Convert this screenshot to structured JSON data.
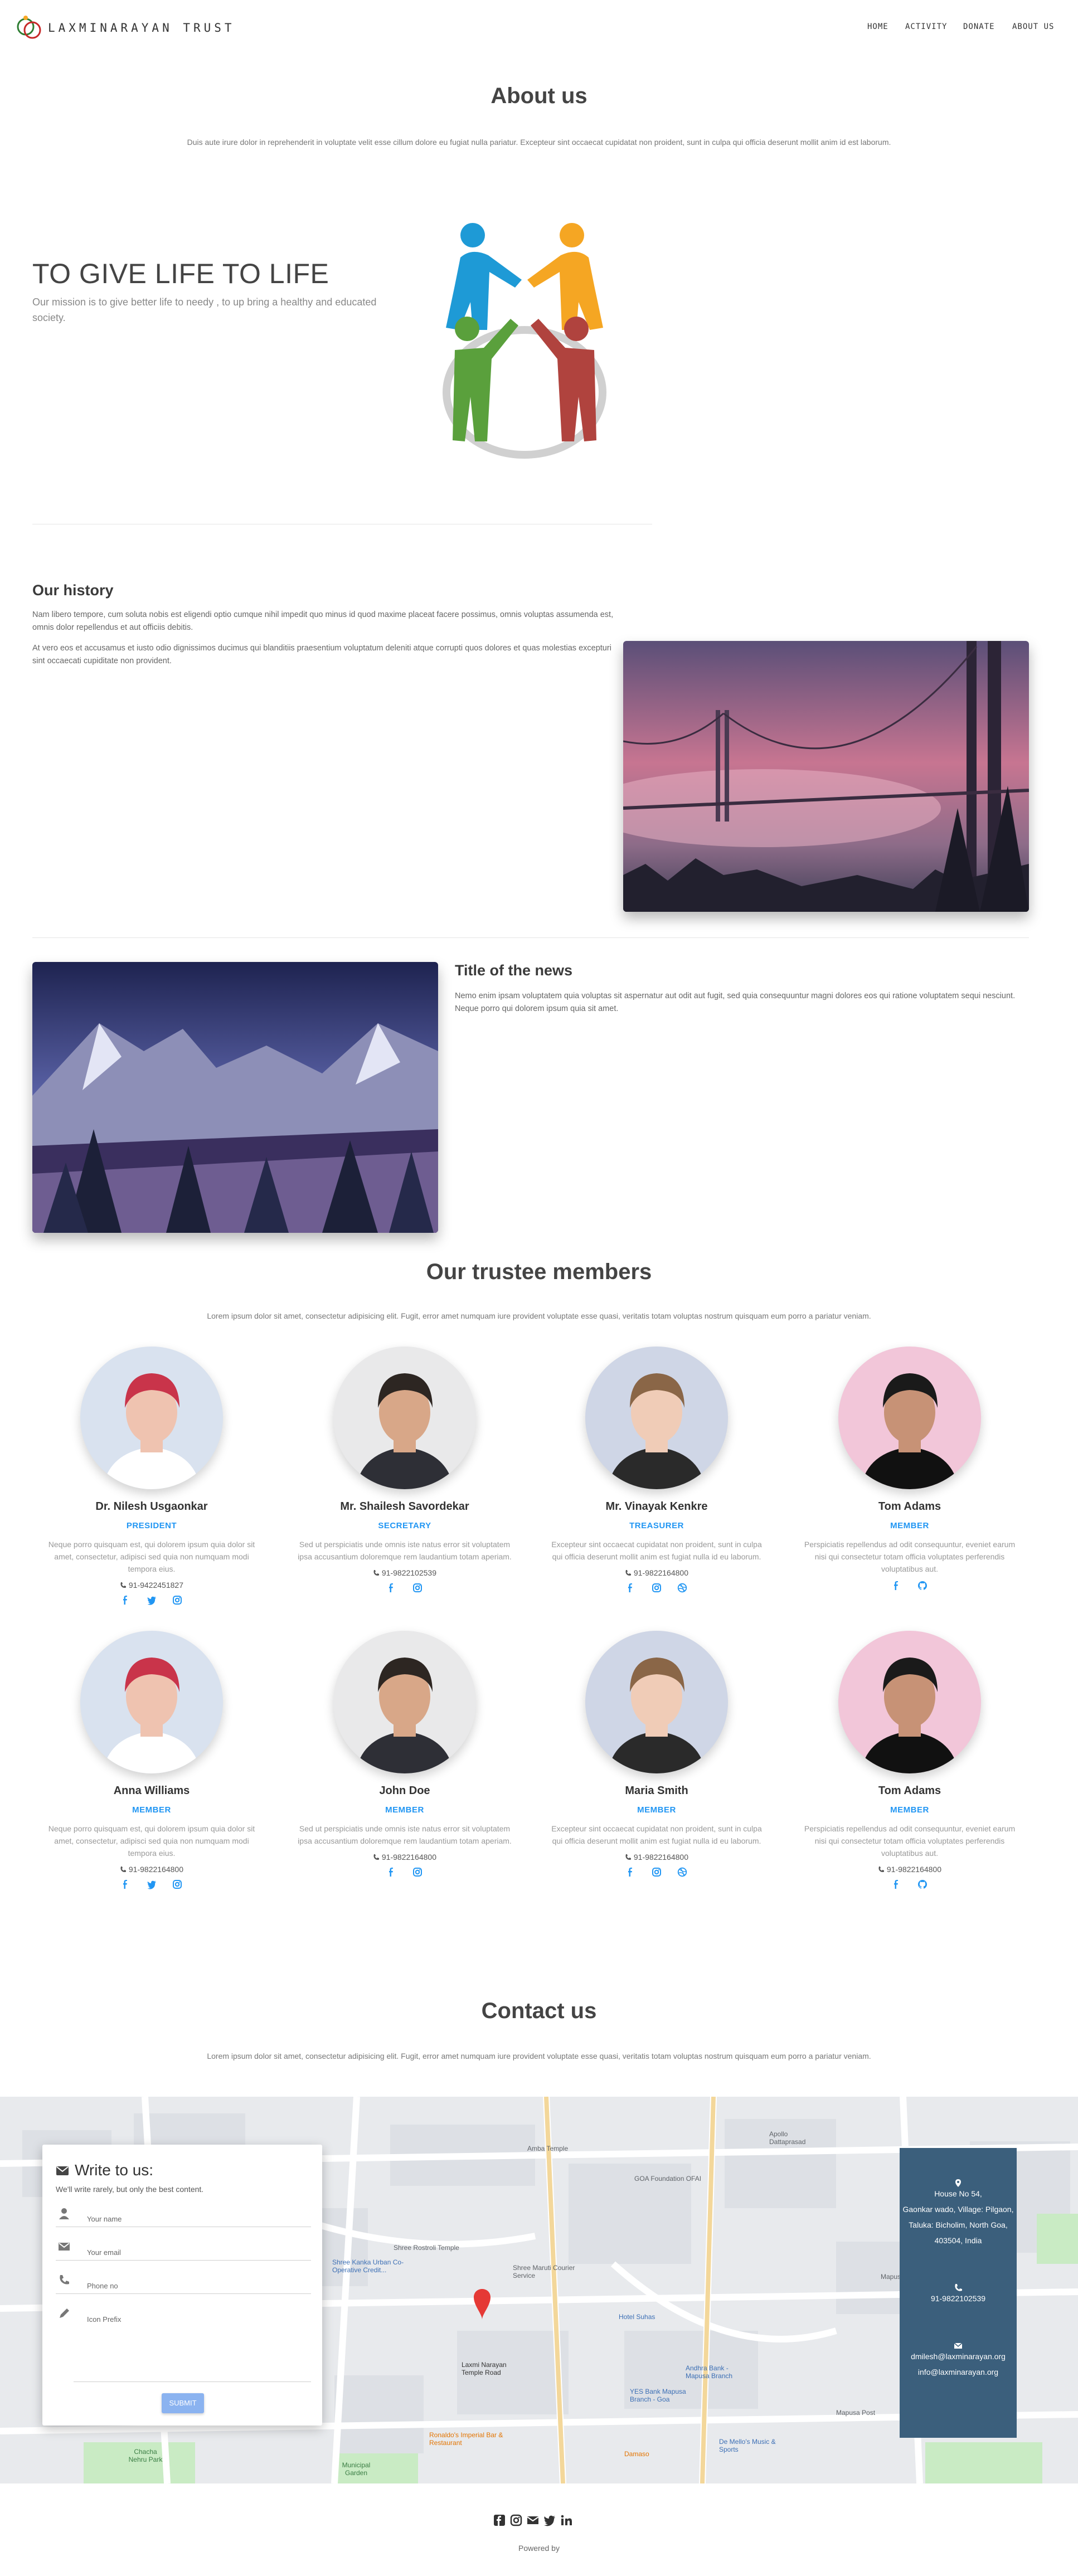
{
  "nav": {
    "brand": "LAXMINARAYAN TRUST",
    "links": [
      "HOME",
      "ACTIVITY",
      "DONATE",
      "ABOUT US"
    ]
  },
  "about": {
    "title": "About us",
    "lead": "Duis aute irure dolor in reprehenderit in voluptate velit esse cillum dolore eu fugiat nulla pariatur. Excepteur sint occaecat cupidatat non proident, sunt in culpa qui officia deserunt mollit anim id est laborum.",
    "hero_title": "TO GIVE LIFE TO LIFE",
    "hero_sub": "Our mission is to give better life to needy , to up bring a healthy and educated society."
  },
  "history": {
    "title": "Our history",
    "p1": "Nam libero tempore, cum soluta nobis est eligendi optio cumque nihil impedit quo minus id quod maxime placeat facere possimus, omnis voluptas assumenda est, omnis dolor repellendus et aut officiis debitis.",
    "p2": "At vero eos et accusamus et iusto odio dignissimos ducimus qui blanditiis praesentium voluptatum deleniti atque corrupti quos dolores et quas molestias excepturi sint occaecati cupiditate non provident."
  },
  "news": {
    "title": "Title of the news",
    "text": "Nemo enim ipsam voluptatem quia voluptas sit aspernatur aut odit aut fugit, sed quia consequuntur magni dolores eos qui ratione voluptatem sequi nesciunt. Neque porro qui dolorem ipsum quia sit amet."
  },
  "trustees": {
    "title": "Our trustee members",
    "lead": "Lorem ipsum dolor sit amet, consectetur adipisicing elit. Fugit, error amet numquam iure provident voluptate esse quasi, veritatis totam voluptas nostrum quisquam eum porro a pariatur veniam.",
    "members": [
      {
        "name": "Dr. Nilesh Usgaonkar",
        "role": "PRESIDENT",
        "desc": "Neque porro quisquam est, qui dolorem ipsum quia dolor sit amet, consectetur, adipisci sed quia non numquam modi tempora eius.",
        "phone": "91-9422451827",
        "social": [
          "facebook",
          "twitter",
          "instagram"
        ]
      },
      {
        "name": "Mr. Shailesh Savordekar",
        "role": "SECRETARY",
        "desc": "Sed ut perspiciatis unde omnis iste natus error sit voluptatem ipsa accusantium doloremque rem laudantium totam aperiam.",
        "phone": "91-9822102539",
        "social": [
          "facebook",
          "instagram"
        ]
      },
      {
        "name": "Mr. Vinayak Kenkre",
        "role": "TREASURER",
        "desc": "Excepteur sint occaecat cupidatat non proident, sunt in culpa qui officia deserunt mollit anim est fugiat nulla id eu laborum.",
        "phone": "91-9822164800",
        "social": [
          "facebook",
          "instagram",
          "dribbble"
        ]
      },
      {
        "name": "Tom Adams",
        "role": "MEMBER",
        "desc": "Perspiciatis repellendus ad odit consequuntur, eveniet earum nisi qui consectetur totam officia voluptates perferendis voluptatibus aut.",
        "phone": "",
        "social": [
          "facebook",
          "github"
        ]
      },
      {
        "name": "Anna Williams",
        "role": "MEMBER",
        "desc": "Neque porro quisquam est, qui dolorem ipsum quia dolor sit amet, consectetur, adipisci sed quia non numquam modi tempora eius.",
        "phone": "91-9822164800",
        "social": [
          "facebook",
          "twitter",
          "instagram"
        ]
      },
      {
        "name": "John Doe",
        "role": "MEMBER",
        "desc": "Sed ut perspiciatis unde omnis iste natus error sit voluptatem ipsa accusantium doloremque rem laudantium totam aperiam.",
        "phone": "91-9822164800",
        "social": [
          "facebook",
          "instagram"
        ]
      },
      {
        "name": "Maria Smith",
        "role": "MEMBER",
        "desc": "Excepteur sint occaecat cupidatat non proident, sunt in culpa qui officia deserunt mollit anim est fugiat nulla id eu laborum.",
        "phone": "91-9822164800",
        "social": [
          "facebook",
          "instagram",
          "dribbble"
        ]
      },
      {
        "name": "Tom Adams",
        "role": "MEMBER",
        "desc": "Perspiciatis repellendus ad odit consequuntur, eveniet earum nisi qui consectetur totam officia voluptates perferendis voluptatibus aut.",
        "phone": "91-9822164800",
        "social": [
          "facebook",
          "github"
        ]
      }
    ]
  },
  "contact": {
    "title": "Contact us",
    "lead": "Lorem ipsum dolor sit amet, consectetur adipisicing elit. Fugit, error amet numquam iure provident voluptate esse quasi, veritatis totam voluptas nostrum quisquam eum porro a pariatur veniam.",
    "form": {
      "title": "Write to us:",
      "subtitle": "We'll write rarely, but only the best content.",
      "name_placeholder": "Your name",
      "email_placeholder": "Your email",
      "phone_placeholder": "Phone no",
      "message_placeholder": "Icon Prefix",
      "submit": "SUBMIT"
    },
    "info": {
      "address": [
        "House No 54,",
        "Gaonkar wado, Village: Pilgaon,",
        "Taluka: Bicholim, North Goa,",
        "403504, India"
      ],
      "phone": "91-9822102539",
      "emails": [
        "dmilesh@laxminarayan.org",
        "info@laxminarayan.org"
      ]
    },
    "map_labels": [
      "Amba Temple",
      "Apollo Dattaprasad",
      "GOA Foundation OFAI",
      "Shree Rostroli Temple",
      "Shree Kanka Urban Co-Operative Credit...",
      "Shree Maruti Courier Service",
      "Hotel Suhas",
      "Mapusa Police",
      "Laxmi Narayan Temple Road",
      "Andhra Bank - Mapusa Branch",
      "YES Bank Mapusa Branch - Goa",
      "Ronaldo's Imperial Bar & Restaurant",
      "Chacha Nehru Park",
      "Municipal Garden",
      "De Mello's Music & Sports",
      "Mapusa Post",
      "Damaso"
    ],
    "map_pin_caption": "Laxmi Narayan Temple Road"
  },
  "footer": {
    "powered": "Powered by",
    "icons": [
      "facebook-square",
      "instagram",
      "envelope",
      "twitter",
      "linkedin"
    ]
  },
  "colors": {
    "accent": "#2196f3",
    "info_card": "#3b5f7c",
    "submit": "#8bb3f0"
  }
}
